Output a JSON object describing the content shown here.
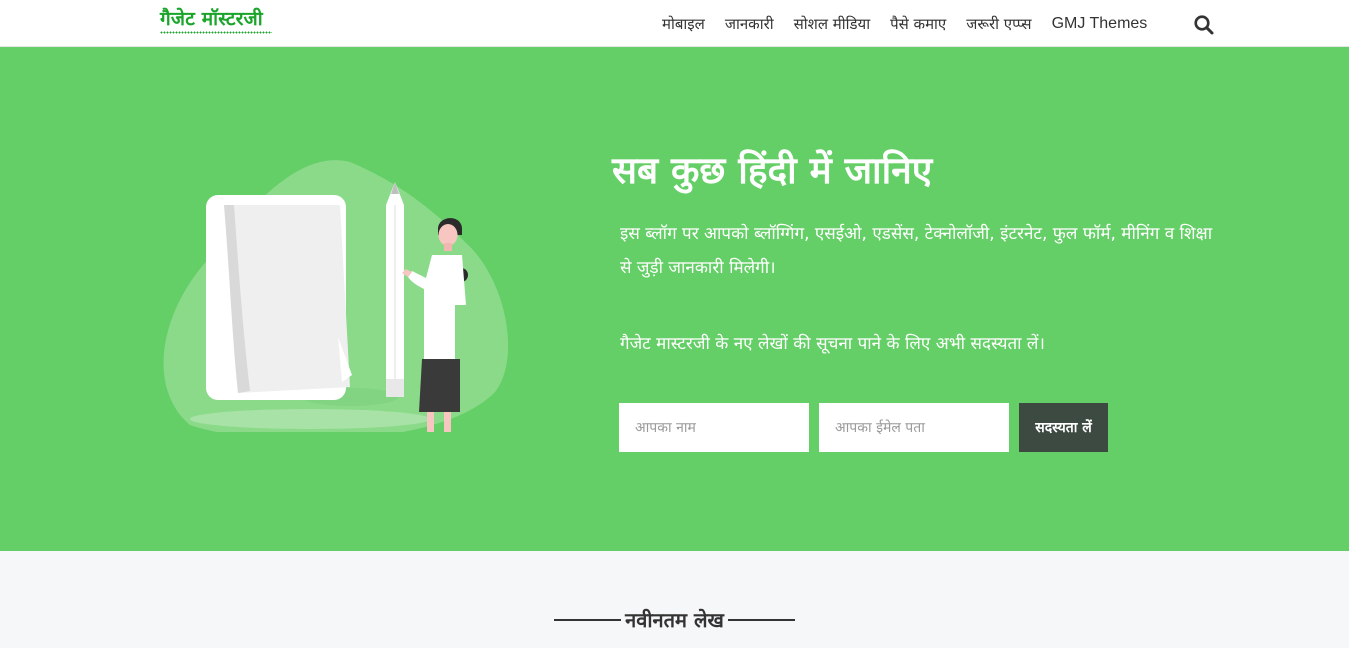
{
  "header": {
    "logo_text": "गैजेट मॉस्टरजी",
    "nav": [
      {
        "label": "मोबाइल"
      },
      {
        "label": "जानकारी"
      },
      {
        "label": "सोशल मीडिया"
      },
      {
        "label": "पैसे कमाए"
      },
      {
        "label": "जरूरी एप्प्स"
      },
      {
        "label": "GMJ Themes"
      }
    ],
    "search_icon": "search-icon"
  },
  "hero": {
    "title": "सब कुछ हिंदी में जानिए",
    "description": "इस ब्लॉग पर आपको ब्लॉग्गिंग, एसईओ, एडसेंस, टेक्नोलॉजी, इंटरनेट, फुल फॉर्म, मीनिंग व शिक्षा से जुड़ी जानकारी मिलेगी।",
    "subscribe_text": "गैजेट मास्टरजी के नए लेखों की सूचना पाने के लिए अभी सदस्यता लें।",
    "name_placeholder": "आपका नाम",
    "email_placeholder": "आपका ईमेल पता",
    "subscribe_button": "सदस्यता लें"
  },
  "latest": {
    "heading": "नवीनतम लेख"
  },
  "colors": {
    "hero_bg": "#64cf66",
    "logo_green": "#1aa52a",
    "button_bg": "#3c4a42",
    "page_bg": "#f6f7f9"
  }
}
